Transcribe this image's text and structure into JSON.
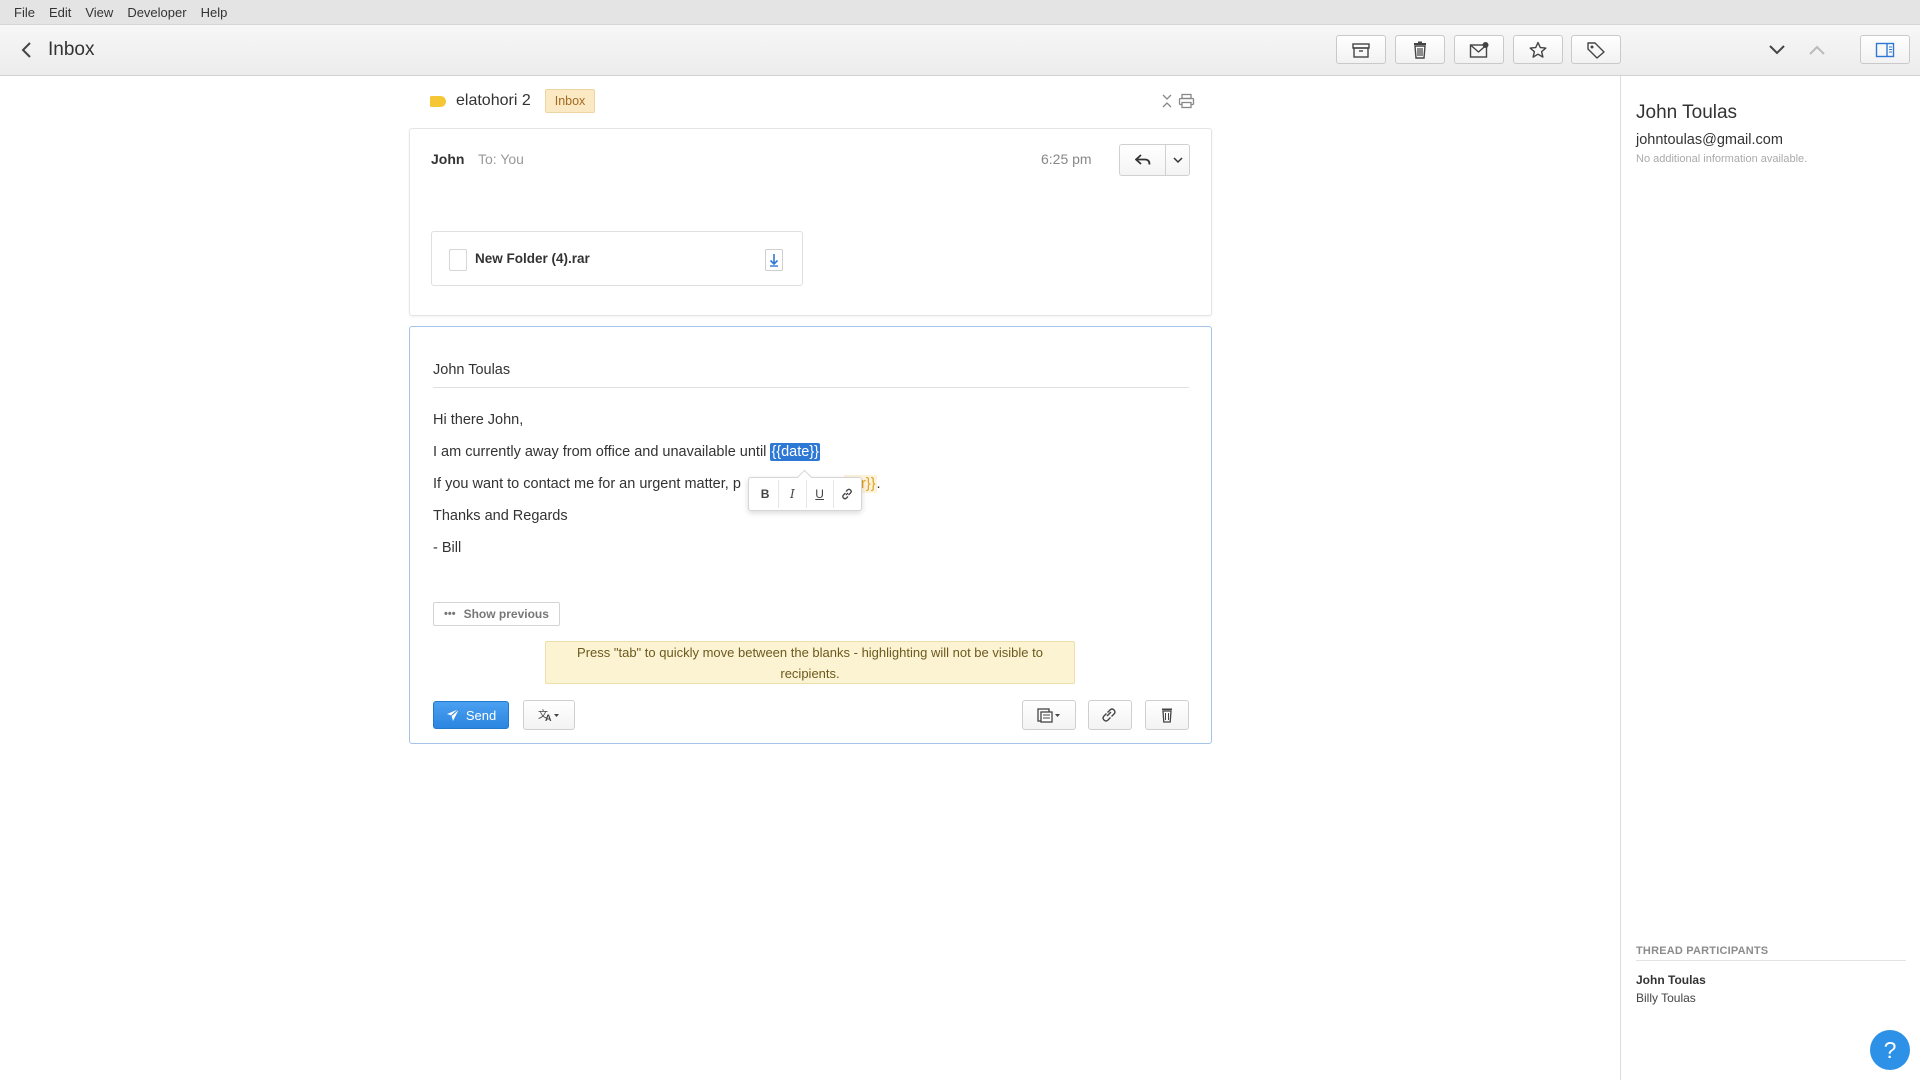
{
  "menubar": {
    "items": [
      "File",
      "Edit",
      "View",
      "Developer",
      "Help"
    ]
  },
  "toolbar": {
    "back_label": "Inbox",
    "icons": {
      "archive": "archive-icon",
      "trash": "trash-icon",
      "mark_unread": "envelope-icon",
      "star": "star-icon",
      "label": "tag-icon",
      "next": "chevron-down-icon",
      "prev": "chevron-up-icon",
      "sidebar": "sidebar-toggle-icon"
    }
  },
  "thread": {
    "subject": "elatohori 2",
    "label": "Inbox"
  },
  "message": {
    "from": "John",
    "to": "To: You",
    "time": "6:25 pm",
    "attachment": {
      "name": "New Folder (4).rar"
    }
  },
  "composer": {
    "recipient": "John Toulas",
    "lines": {
      "l1": "Hi there John,",
      "l2_pre": "I am currently away from office and unavailable until ",
      "l2_var": "{{date}}",
      "l3_pre": "If you want to contact me for an urgent matter, p",
      "l3_var": "ber}}",
      "l3_post": ".",
      "l4": "Thanks and Regards",
      "l5": "- Bill"
    },
    "format_toolbar": {
      "bold": "B",
      "italic": "I",
      "underline": "U"
    },
    "show_previous": "Show previous",
    "hint": "Press \"tab\" to quickly move between the blanks - highlighting will not be visible to recipients.",
    "send_label": "Send"
  },
  "sidebar": {
    "contact_name": "John Toulas",
    "contact_email": "johntoulas@gmail.com",
    "contact_info": "No additional information available.",
    "participants_title": "THREAD PARTICIPANTS",
    "participants": [
      "John Toulas",
      "Billy Toulas"
    ]
  },
  "help": {
    "label": "?"
  },
  "colors": {
    "accent": "#2e78d5",
    "send": "#2c86e0",
    "label_tag": "#f5c734",
    "hint_bg": "#fcf3d3"
  }
}
